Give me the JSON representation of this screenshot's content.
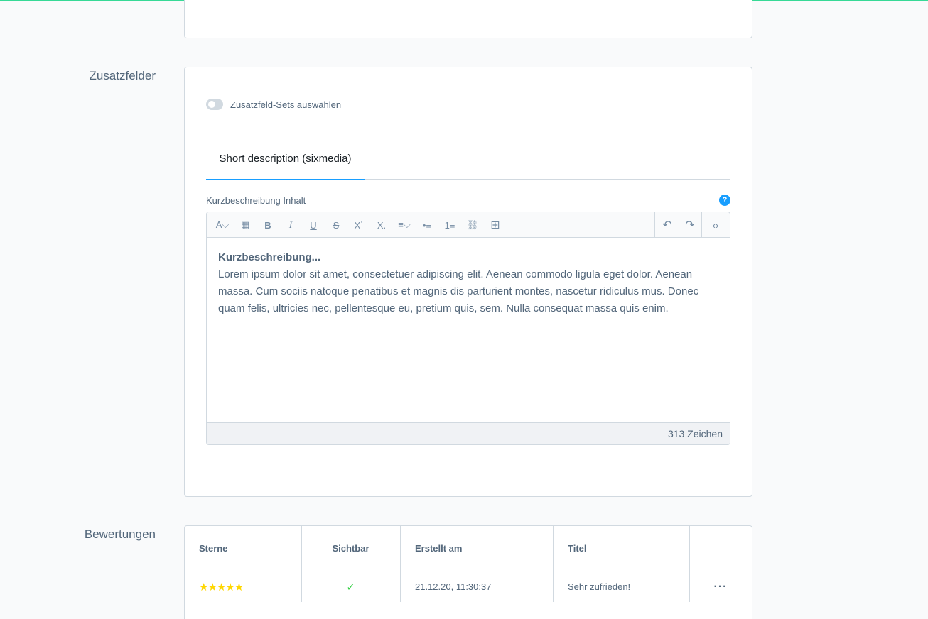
{
  "colors": {
    "accent": "#189eff",
    "top_bar": "#37d996",
    "star": "#ffd700",
    "check": "#37d046"
  },
  "sections": {
    "custom_fields": "Zusatzfelder",
    "reviews": "Bewertungen"
  },
  "custom_fields": {
    "toggle_label": "Zusatzfeld-Sets auswählen",
    "toggle_on": false,
    "tab_label": "Short description (sixmedia)",
    "field_label": "Kurzbeschreibung Inhalt",
    "help": "?",
    "editor": {
      "toolbar": [
        {
          "icon": "text-style-icon",
          "glyph": "A⌵"
        },
        {
          "icon": "color-icon",
          "glyph": "▦"
        },
        {
          "icon": "bold-icon",
          "glyph": "B"
        },
        {
          "icon": "italic-icon",
          "glyph": "I"
        },
        {
          "icon": "underline-icon",
          "glyph": "U"
        },
        {
          "icon": "strikethrough-icon",
          "glyph": "S"
        },
        {
          "icon": "superscript-icon",
          "glyph": "X˙"
        },
        {
          "icon": "subscript-icon",
          "glyph": "X."
        },
        {
          "icon": "align-icon",
          "glyph": "≡⌵"
        },
        {
          "icon": "unordered-list-icon",
          "glyph": "•≡"
        },
        {
          "icon": "ordered-list-icon",
          "glyph": "1≡"
        },
        {
          "icon": "link-icon",
          "glyph": "⛓"
        },
        {
          "icon": "table-icon",
          "glyph": "⊞"
        },
        {
          "icon": "undo-icon",
          "glyph": "↶"
        },
        {
          "icon": "redo-icon",
          "glyph": "↷"
        },
        {
          "icon": "code-view-icon",
          "glyph": "‹›"
        }
      ],
      "content_heading": "Kurzbeschreibung...",
      "content_body": "Lorem ipsum dolor sit amet, consectetuer adipiscing elit. Aenean commodo ligula eget dolor. Aenean massa. Cum sociis natoque penatibus et magnis dis parturient montes, nascetur ridiculus mus. Donec quam felis, ultricies nec, pellentesque eu, pretium quis, sem. Nulla consequat massa quis enim.",
      "char_count": "313 Zeichen"
    }
  },
  "reviews": {
    "columns": [
      "Sterne",
      "Sichtbar",
      "Erstellt am",
      "Titel"
    ],
    "rows": [
      {
        "stars": "★★★★★",
        "rating": 5,
        "visible": "✓",
        "created": "21.12.20, 11:30:37",
        "title": "Sehr zufrieden!",
        "actions": "···"
      }
    ]
  }
}
